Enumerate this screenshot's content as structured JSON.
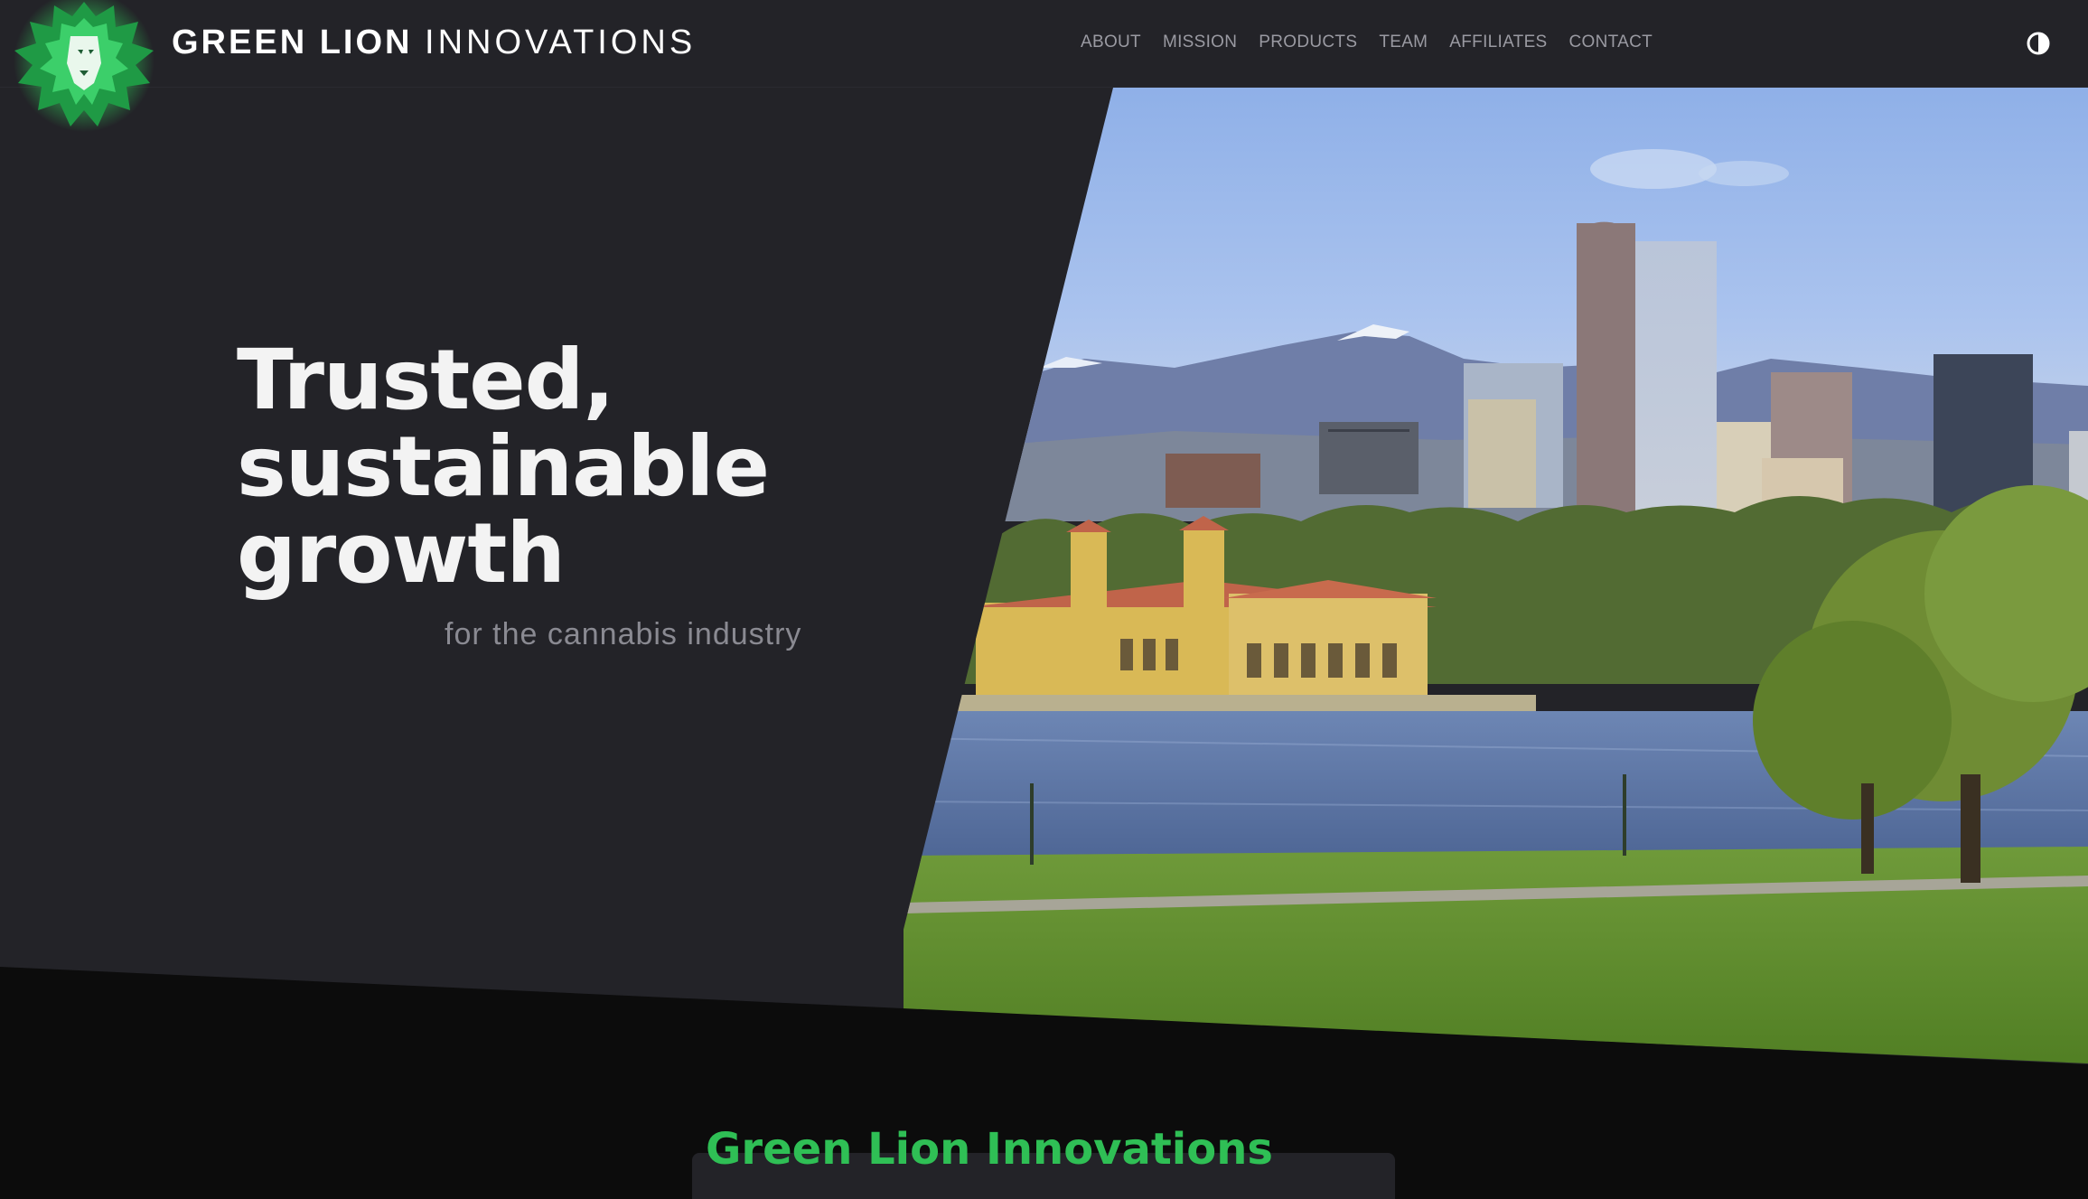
{
  "header": {
    "brand_bold": "GREEN LION",
    "brand_light": "INNOVATIONS",
    "logo_icon": "lion-head-logo",
    "nav": [
      "ABOUT",
      "MISSION",
      "PRODUCTS",
      "TEAM",
      "AFFILIATES",
      "CONTACT"
    ],
    "theme_toggle_icon": "contrast-half-circle-icon"
  },
  "hero": {
    "title_line1": "Trusted,",
    "title_line2": "sustainable",
    "title_line3": "growth",
    "subtitle": "for the cannabis industry",
    "image_subject": "city skyline with mountains, pavilion by a lake and park lawn"
  },
  "section": {
    "title": "Green Lion Innovations"
  },
  "colors": {
    "header_bg": "#232328",
    "hero_bg": "#232328",
    "band_bg": "#0c0c0c",
    "accent_green": "#2fbf55",
    "nav_text": "#9a9aa2"
  }
}
